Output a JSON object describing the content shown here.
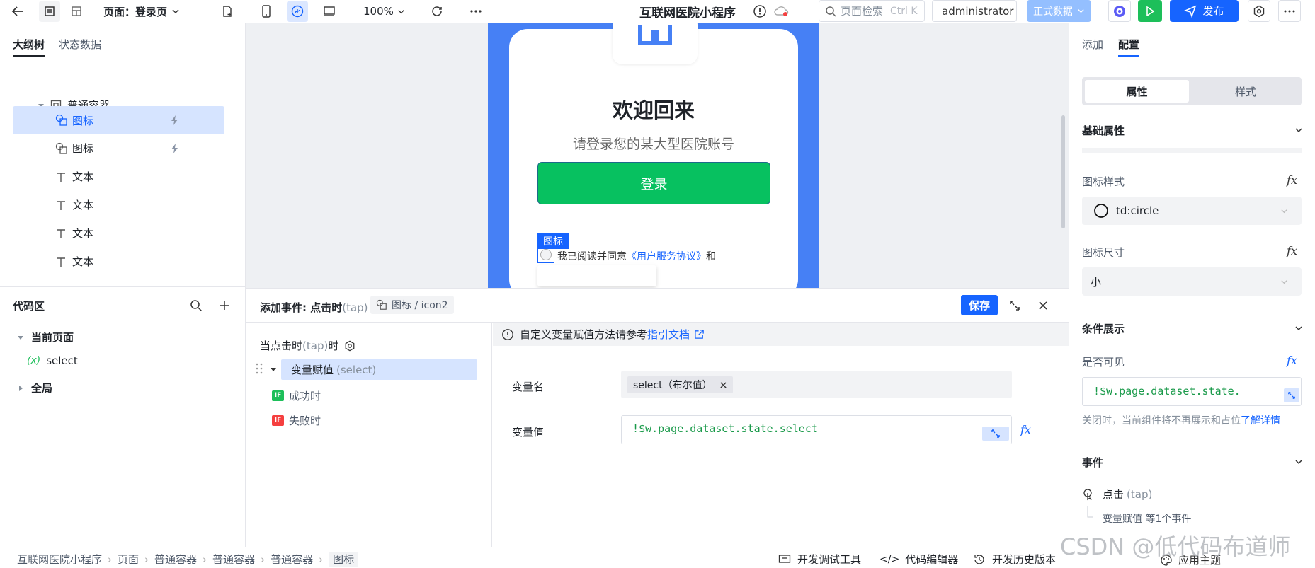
{
  "topbar": {
    "page_label": "页面：登录页",
    "zoom": "100%",
    "app_title": "互联网医院小程序",
    "search_placeholder": "页面检索",
    "search_shortcut": "Ctrl K",
    "user": "administrator",
    "env": "正式数据",
    "publish": "发布"
  },
  "left": {
    "tabs": [
      "大纲树",
      "状态数据"
    ],
    "tree": [
      {
        "label": "普通容器",
        "icon": "container-icon"
      },
      {
        "label": "图标",
        "icon": "icon-component-icon",
        "selected": true
      },
      {
        "label": "图标",
        "icon": "icon-component-icon"
      },
      {
        "label": "文本",
        "icon": "text-icon"
      },
      {
        "label": "文本",
        "icon": "text-icon"
      },
      {
        "label": "文本",
        "icon": "text-icon"
      },
      {
        "label": "文本",
        "icon": "text-icon"
      }
    ],
    "code_title": "代码区",
    "code_current": "当前页面",
    "code_var": "select",
    "code_var_prefix": "(x)",
    "code_global": "全局"
  },
  "canvas": {
    "welcome": "欢迎回来",
    "subtitle": "请登录您的某大型医院账号",
    "login_button": "登录",
    "selection_tag": "图标",
    "agree_text": "我已阅读并同意",
    "agreement_link": "《用户服务协议》",
    "and_text": "和"
  },
  "event": {
    "title": "添加事件: 点击时",
    "title_tap": "(tap)",
    "target": "图标 / icon2",
    "save": "保存",
    "trigger": "当点击时",
    "trigger_tap": "(tap)",
    "trigger_suffix": "时",
    "action_label": "变量赋值",
    "action_sub": "(select)",
    "success": "成功时",
    "fail": "失败时",
    "if_badge": "IF",
    "notice": "自定义变量赋值方法请参考",
    "notice_link": "指引文档",
    "var_name_label": "变量名",
    "var_name_tag": "select（布尔值）",
    "var_value_label": "变量值",
    "var_value": "!$w.page.dataset.state.select"
  },
  "right": {
    "tabs": [
      "添加",
      "配置"
    ],
    "seg": [
      "属性",
      "样式"
    ],
    "basic": "基础属性",
    "icon_style_label": "图标样式",
    "icon_style_value": "td:circle",
    "icon_size_label": "图标尺寸",
    "icon_size_value": "小",
    "cond": "条件展示",
    "visible_label": "是否可见",
    "visible_value": "!$w.page.dataset.state.",
    "hint": "关闭时，当前组件将不再展示和占位",
    "hint_link": "了解详情",
    "events": "事件",
    "event_name": "点击",
    "event_tap": "(tap)",
    "event_desc": "变量赋值 等1个事件",
    "theme": "应用主题"
  },
  "status": {
    "crumbs": [
      "互联网医院小程序",
      "页面",
      "普通容器",
      "普通容器",
      "普通容器",
      "图标"
    ],
    "dev_tools": "开发调试工具",
    "code_editor": "代码编辑器",
    "history": "开发历史版本"
  },
  "watermark": "CSDN @低代码布道师",
  "colors": {
    "primary": "#1664ff",
    "green": "#07c160",
    "phone_bg": "#4680f5",
    "run": "#1dbf5a"
  }
}
